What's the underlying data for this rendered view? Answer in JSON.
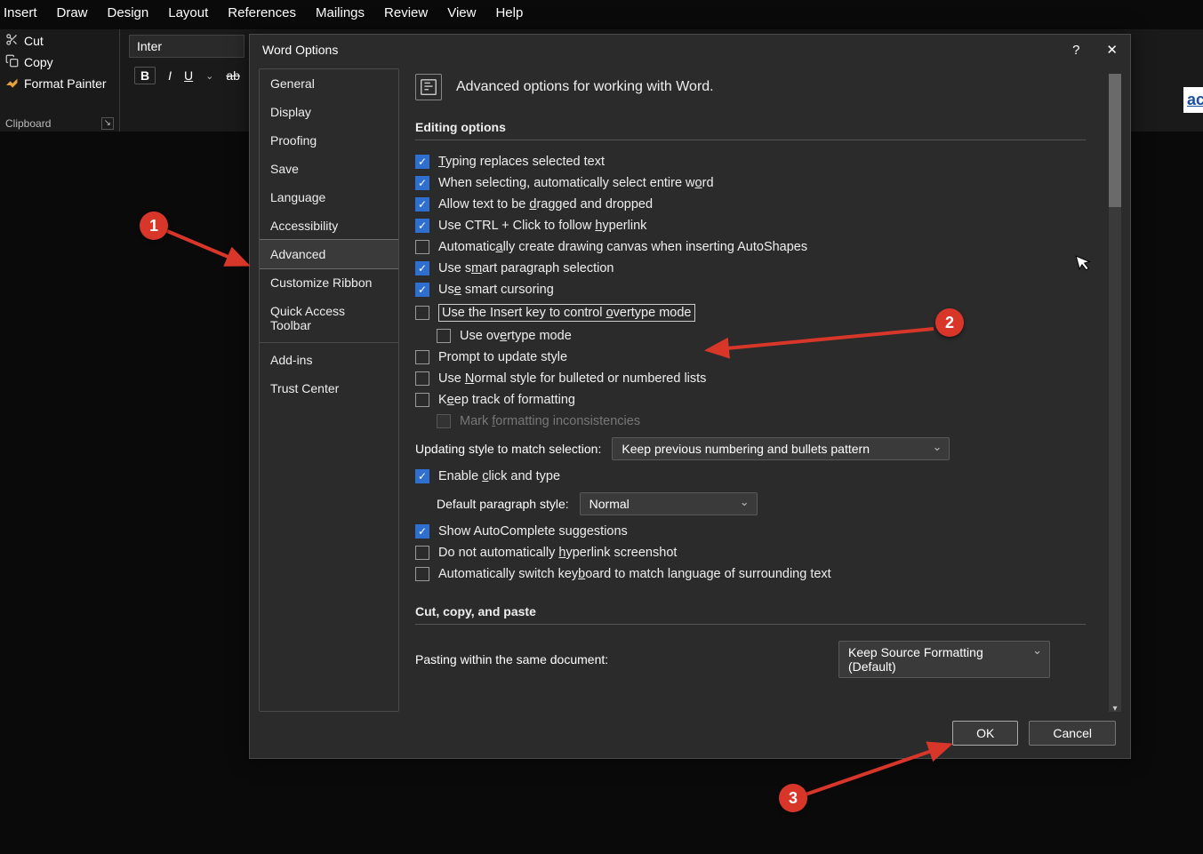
{
  "ribbon": {
    "tabs": [
      "Insert",
      "Draw",
      "Design",
      "Layout",
      "References",
      "Mailings",
      "Review",
      "View",
      "Help"
    ]
  },
  "clipboard": {
    "cut": "Cut",
    "copy": "Copy",
    "format_painter": "Format Painter",
    "group_label": "Clipboard"
  },
  "font": {
    "name": "Inter",
    "bold": "B",
    "italic": "I",
    "underline": "U"
  },
  "dialog": {
    "title": "Word Options",
    "help": "?",
    "close": "✕",
    "sidebar": {
      "items": [
        "General",
        "Display",
        "Proofing",
        "Save",
        "Language",
        "Accessibility",
        "Advanced",
        "Customize Ribbon",
        "Quick Access Toolbar",
        "Add-ins",
        "Trust Center"
      ],
      "selected_index": 6
    },
    "header": "Advanced options for working with Word.",
    "section_editing": "Editing options",
    "options": {
      "typing_replaces": "Typing replaces selected text",
      "auto_select_word_pre": "When selecting, automatically select entire w",
      "auto_select_word_u": "o",
      "auto_select_word_post": "rd",
      "drag_drop_pre": "Allow text to be ",
      "drag_drop_u": "d",
      "drag_drop_post": "ragged and dropped",
      "ctrl_click_pre": "Use CTRL + Click to follow ",
      "ctrl_click_u": "h",
      "ctrl_click_post": "yperlink",
      "auto_canvas_pre": "Automatic",
      "auto_canvas_u": "a",
      "auto_canvas_post": "lly create drawing canvas when inserting AutoShapes",
      "smart_para_pre": "Use s",
      "smart_para_u": "m",
      "smart_para_post": "art paragraph selection",
      "smart_cursor_pre": "Us",
      "smart_cursor_u": "e",
      "smart_cursor_post": " smart cursoring",
      "insert_key_pre": "Use the Insert key to control ",
      "insert_key_u": "o",
      "insert_key_post": "vertype mode",
      "overtype_pre": "Use ov",
      "overtype_u": "e",
      "overtype_post": "rtype mode",
      "prompt_style": "Prompt to update style",
      "normal_bullets_pre": "Use ",
      "normal_bullets_u": "N",
      "normal_bullets_post": "ormal style for bulleted or numbered lists",
      "keep_track_pre": "K",
      "keep_track_u": "e",
      "keep_track_post": "ep track of formatting",
      "mark_inconsist_pre": "Mark ",
      "mark_inconsist_u": "f",
      "mark_inconsist_post": "ormatting inconsistencies",
      "updating_style_label_pre": "",
      "updating_style_label_u": "U",
      "updating_style_label_post": "pdating style to match selection:",
      "updating_style_value": "Keep previous numbering and bullets pattern",
      "enable_click_pre": "Enable ",
      "enable_click_u": "c",
      "enable_click_post": "lick and type",
      "default_para_label": "Default paragraph style:",
      "default_para_value": "Normal",
      "autocomplete": "Show AutoComplete suggestions",
      "no_hyperlink_ss_pre": "Do not automatically ",
      "no_hyperlink_ss_u": "h",
      "no_hyperlink_ss_post": "yperlink screenshot",
      "switch_kb_pre": "Automatically switch key",
      "switch_kb_u": "b",
      "switch_kb_post": "oard to match language of surrounding text"
    },
    "section_paste": "Cut, copy, and paste",
    "paste_within_label_pre": "Pasting ",
    "paste_within_label_u": "w",
    "paste_within_label_post": "ithin the same document:",
    "paste_within_value": "Keep Source Formatting (Default)",
    "ok": "OK",
    "cancel": "Cancel"
  },
  "annotations": {
    "c1": "1",
    "c2": "2",
    "c3": "3"
  },
  "edge_text": "aci"
}
